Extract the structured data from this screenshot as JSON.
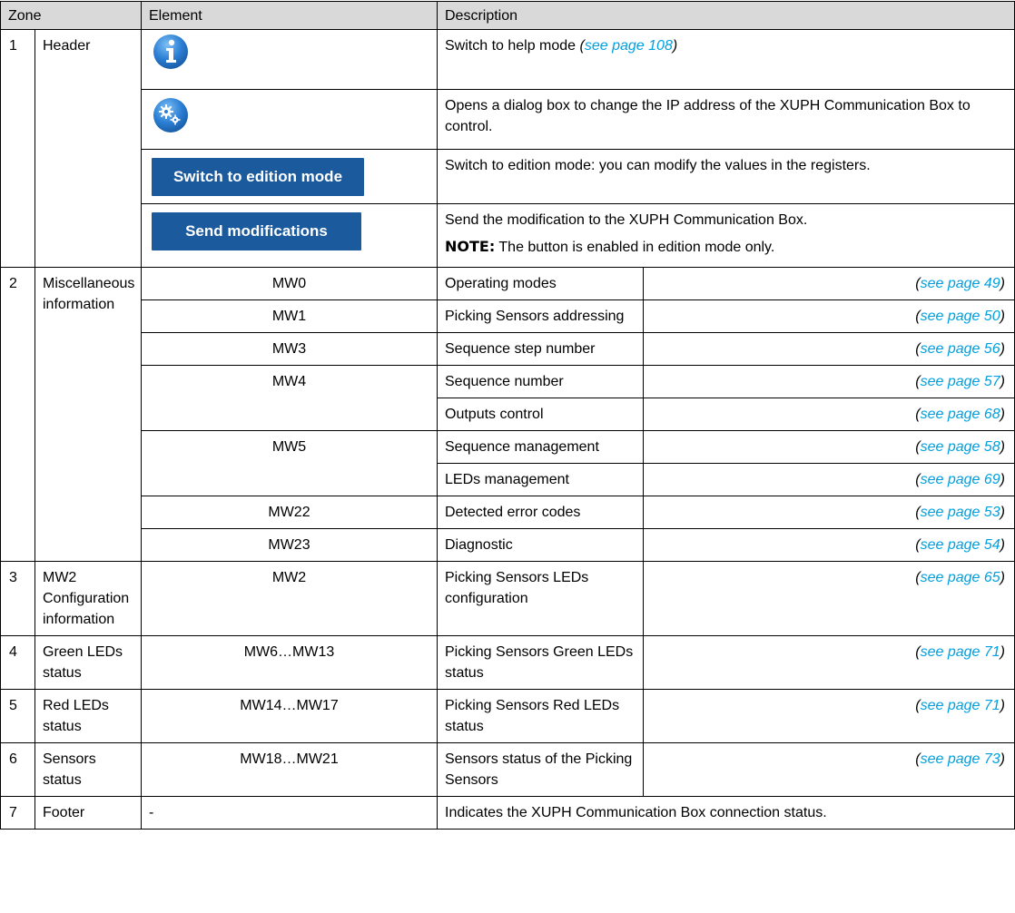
{
  "headers": {
    "zone": "Zone",
    "element": "Element",
    "description": "Description"
  },
  "header_rows": {
    "zone_num": "1",
    "zone_name": "Header",
    "help_desc": "Switch to help mode",
    "help_link": "see page 108",
    "settings_desc": "Opens a dialog box to change the IP address of the XUPH Communication Box to control.",
    "edition_button": "Switch to edition mode",
    "edition_desc": "Switch to edition mode: you can modify the values in the registers.",
    "send_button": "Send modifications",
    "send_desc": "Send the modification to the XUPH Communication Box.",
    "note_label": "NOTE:",
    "note_text": " The button is enabled in edition mode only."
  },
  "zone2": {
    "num": "2",
    "name": "Miscellaneous information",
    "rows": [
      {
        "element": "MW0",
        "desc": "Operating modes",
        "link": "see page 49"
      },
      {
        "element": "MW1",
        "desc": "Picking Sensors addressing",
        "link": "see page 50"
      },
      {
        "element": "MW3",
        "desc": "Sequence step number",
        "link": "see page 56"
      },
      {
        "element": "MW4",
        "desc": "Sequence number",
        "link": "see page 57"
      },
      {
        "element": "",
        "desc": "Outputs control",
        "link": "see page 68"
      },
      {
        "element": "MW5",
        "desc": "Sequence management",
        "link": "see page 58"
      },
      {
        "element": "",
        "desc": "LEDs management",
        "link": "see page 69"
      },
      {
        "element": "MW22",
        "desc": "Detected error codes",
        "link": "see page 53"
      },
      {
        "element": "MW23",
        "desc": "Diagnostic",
        "link": "see page 54"
      }
    ]
  },
  "zones": [
    {
      "num": "3",
      "name": "MW2 Configuration information",
      "element": "MW2",
      "desc": "Picking Sensors LEDs configuration",
      "link": "see page 65"
    },
    {
      "num": "4",
      "name": "Green LEDs status",
      "element": "MW6…MW13",
      "desc": "Picking Sensors Green LEDs status",
      "link": "see page 71"
    },
    {
      "num": "5",
      "name": "Red LEDs status",
      "element": "MW14…MW17",
      "desc": "Picking Sensors Red LEDs status",
      "link": "see page 71"
    },
    {
      "num": "6",
      "name": "Sensors status",
      "element": "MW18…MW21",
      "desc": "Sensors status of the Picking Sensors",
      "link": "see page 73"
    }
  ],
  "footer_row": {
    "num": "7",
    "name": "Footer",
    "element": "-",
    "desc": "Indicates the XUPH Communication Box connection status."
  },
  "paren_open": "(",
  "paren_close": ")",
  "icons": {
    "help": "info-icon",
    "settings": "gears-icon"
  },
  "colors": {
    "button": "#1b5a9c",
    "link": "#00a0e0",
    "header_bg": "#d9d9d9"
  }
}
